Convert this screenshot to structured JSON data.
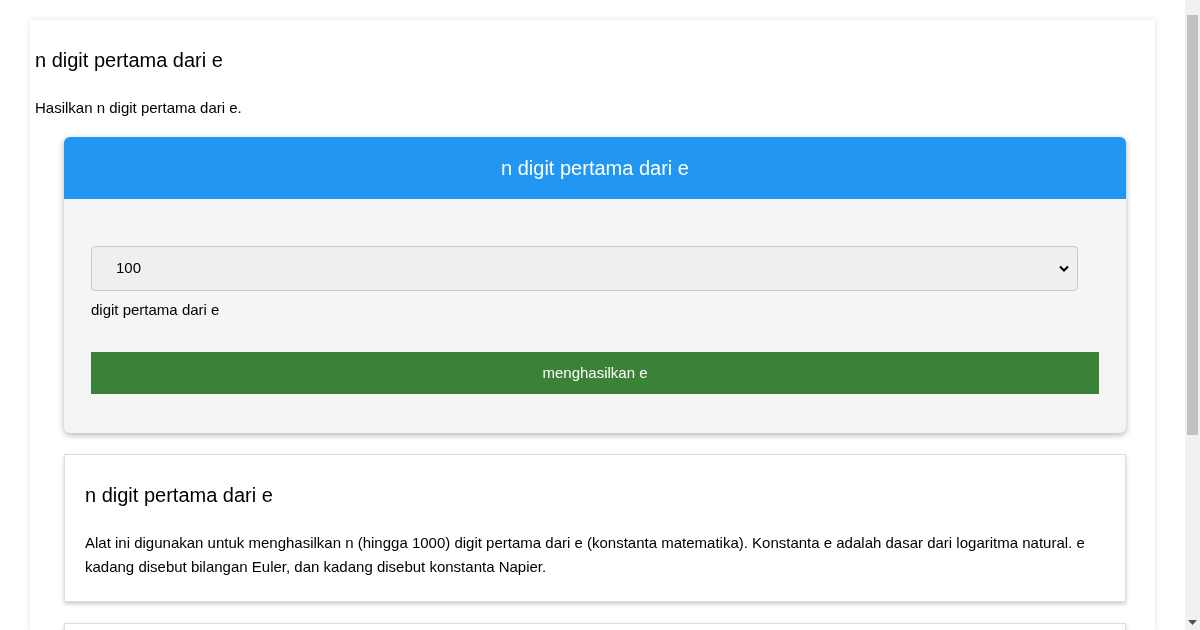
{
  "page": {
    "title": "n digit pertama dari e",
    "intro": "Hasilkan n digit pertama dari e."
  },
  "tool": {
    "header": "n digit pertama dari e",
    "select": {
      "value": "100"
    },
    "select_label": "digit pertama dari e",
    "button": "menghasilkan e"
  },
  "info": {
    "title": "n digit pertama dari e",
    "text": "Alat ini digunakan untuk menghasilkan n (hingga 1000) digit pertama dari e (konstanta matematika). Konstanta e adalah dasar dari logaritma natural. e kadang disebut bilangan Euler, dan kadang disebut konstanta Napier."
  }
}
